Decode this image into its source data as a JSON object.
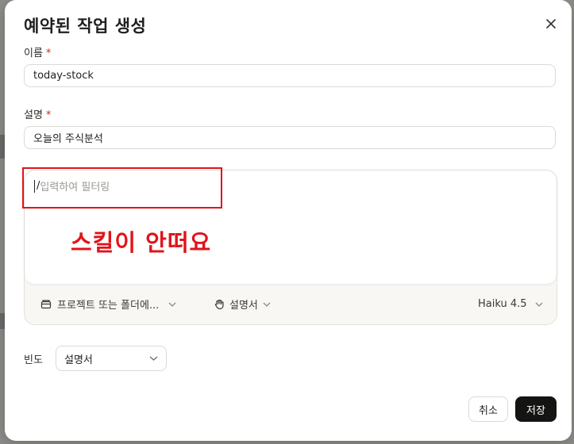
{
  "dialog": {
    "title": "예약된 작업 생성",
    "name_label": "이름",
    "name_value": "today-stock",
    "description_label": "설명",
    "description_value": "오늘의 주식분석",
    "required_mark": "*"
  },
  "prompt": {
    "slash": "/",
    "placeholder": "입력하여 필터링"
  },
  "annotation": {
    "text": "스킬이 안떠요",
    "color": "#e0141a"
  },
  "toolbar": {
    "folder_label": "프로젝트 또는 폴더에...",
    "skill_label": "설명서",
    "model_label": "Haiku 4.5"
  },
  "frequency": {
    "label": "빈도",
    "value": "설명서"
  },
  "buttons": {
    "cancel": "취소",
    "save": "저장"
  },
  "colors": {
    "required": "#b8332c",
    "primary_button": "#141413"
  }
}
